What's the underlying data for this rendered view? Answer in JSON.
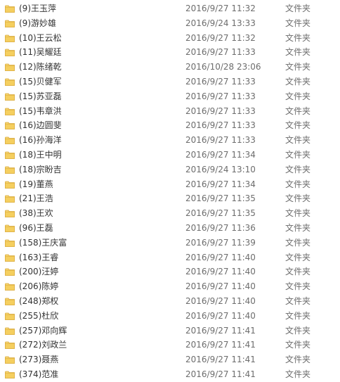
{
  "icons": {
    "folder": "folder-icon"
  },
  "colors": {
    "folder_fill": "#f7d774",
    "folder_tab": "#e8b83f",
    "name_text": "#333333",
    "meta_text": "#6d6d6d"
  },
  "rows": [
    {
      "name": "(9)王玉萍",
      "date": "2016/9/27 11:32",
      "type": "文件夹"
    },
    {
      "name": "(9)游妙雄",
      "date": "2016/9/24 13:33",
      "type": "文件夹"
    },
    {
      "name": "(10)王云松",
      "date": "2016/9/27 11:32",
      "type": "文件夹"
    },
    {
      "name": "(11)吴耀廷",
      "date": "2016/9/27 11:33",
      "type": "文件夹"
    },
    {
      "name": "(12)陈绪乾",
      "date": "2016/10/28 23:06",
      "type": "文件夹"
    },
    {
      "name": "(15)贝健军",
      "date": "2016/9/27 11:33",
      "type": "文件夹"
    },
    {
      "name": "(15)苏亚磊",
      "date": "2016/9/27 11:33",
      "type": "文件夹"
    },
    {
      "name": "(15)韦章洪",
      "date": "2016/9/27 11:33",
      "type": "文件夹"
    },
    {
      "name": "(16)边圆斐",
      "date": "2016/9/27 11:33",
      "type": "文件夹"
    },
    {
      "name": "(16)孙海洋",
      "date": "2016/9/27 11:33",
      "type": "文件夹"
    },
    {
      "name": "(18)王中明",
      "date": "2016/9/27 11:34",
      "type": "文件夹"
    },
    {
      "name": "(18)宗盼吉",
      "date": "2016/9/24 13:10",
      "type": "文件夹"
    },
    {
      "name": "(19)董燕",
      "date": "2016/9/27 11:34",
      "type": "文件夹"
    },
    {
      "name": "(21)王浩",
      "date": "2016/9/27 11:35",
      "type": "文件夹"
    },
    {
      "name": "(38)王欢",
      "date": "2016/9/27 11:35",
      "type": "文件夹"
    },
    {
      "name": "(96)王磊",
      "date": "2016/9/27 11:36",
      "type": "文件夹"
    },
    {
      "name": "(158)王庆富",
      "date": "2016/9/27 11:39",
      "type": "文件夹"
    },
    {
      "name": "(163)王睿",
      "date": "2016/9/27 11:40",
      "type": "文件夹"
    },
    {
      "name": "(200)汪婷",
      "date": "2016/9/27 11:40",
      "type": "文件夹"
    },
    {
      "name": "(206)陈婷",
      "date": "2016/9/27 11:40",
      "type": "文件夹"
    },
    {
      "name": "(248)郑权",
      "date": "2016/9/27 11:40",
      "type": "文件夹"
    },
    {
      "name": "(255)杜欣",
      "date": "2016/9/27 11:40",
      "type": "文件夹"
    },
    {
      "name": "(257)邓向辉",
      "date": "2016/9/27 11:41",
      "type": "文件夹"
    },
    {
      "name": "(272)刘政兰",
      "date": "2016/9/27 11:41",
      "type": "文件夹"
    },
    {
      "name": "(273)聂燕",
      "date": "2016/9/27 11:41",
      "type": "文件夹"
    },
    {
      "name": "(374)范准",
      "date": "2016/9/27 11:41",
      "type": "文件夹"
    }
  ]
}
